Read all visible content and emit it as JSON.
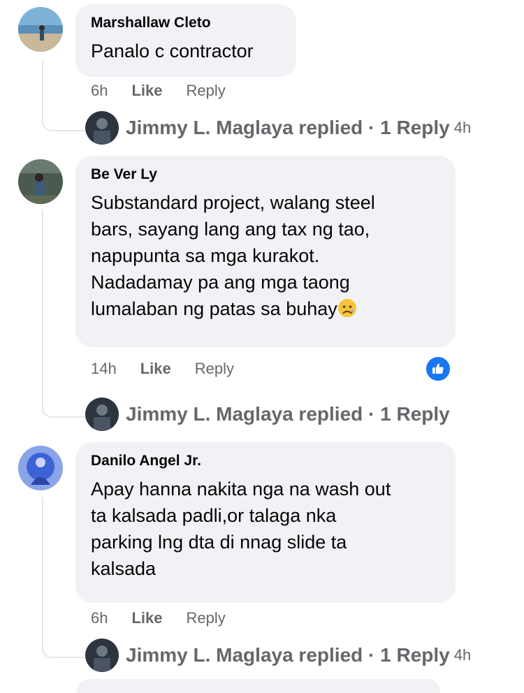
{
  "comments": [
    {
      "author": "Marshallaw Cleto",
      "text": "Panalo c contractor",
      "time": "6h",
      "like_label": "Like",
      "reply_label": "Reply",
      "reply_summary": "Jimmy L. Maglaya replied · 1 Reply",
      "reply_time": "4h"
    },
    {
      "author": "Be Ver Ly",
      "text_lines": [
        "Substandard project, walang steel",
        "bars, sayang lang ang tax ng tao,",
        "napupunta sa mga kurakot.",
        "Nadadamay pa ang mga taong",
        "lumalaban ng patas sa buhay"
      ],
      "time": "14h",
      "like_label": "Like",
      "reply_label": "Reply",
      "reply_summary": "Jimmy L. Maglaya replied · 1 Reply",
      "reaction": "like-icon"
    },
    {
      "author": "Danilo Angel Jr.",
      "text_lines": [
        "Apay hanna nakita nga na wash out",
        "ta kalsada padli,or talaga nka",
        "parking lng dta di nnag slide ta",
        "kalsada"
      ],
      "time": "6h",
      "like_label": "Like",
      "reply_label": "Reply",
      "reply_summary": "Jimmy L. Maglaya replied · 1 Reply",
      "reply_time": "4h"
    }
  ],
  "colors": {
    "bubble": "#f0f2f5",
    "meta_text": "#65676b",
    "like_blue": "#1877f2"
  }
}
